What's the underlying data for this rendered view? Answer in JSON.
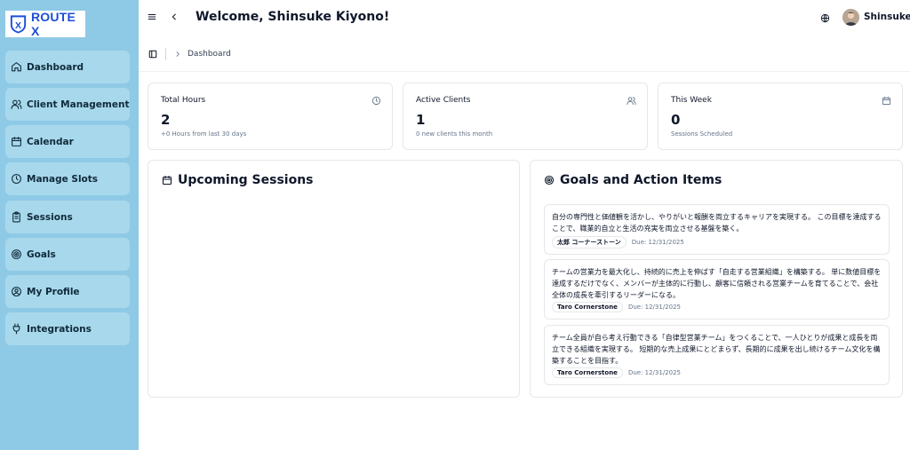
{
  "brand": {
    "logo_text": "ROUTE X",
    "logo_badge": "ROUTE"
  },
  "sidebar": {
    "items": [
      {
        "label": "Dashboard",
        "icon": "home-icon"
      },
      {
        "label": "Client Management",
        "icon": "users-icon"
      },
      {
        "label": "Calendar",
        "icon": "calendar-icon"
      },
      {
        "label": "Manage Slots",
        "icon": "clock-icon"
      },
      {
        "label": "Sessions",
        "icon": "clipboard-icon"
      },
      {
        "label": "Goals",
        "icon": "target-icon"
      },
      {
        "label": "My Profile",
        "icon": "user-circle-icon"
      },
      {
        "label": "Integrations",
        "icon": "plug-icon"
      }
    ]
  },
  "header": {
    "welcome": "Welcome, Shinsuke Kiyono!",
    "user_name": "Shinsuke"
  },
  "breadcrumb": {
    "current": "Dashboard"
  },
  "stats": [
    {
      "title": "Total Hours",
      "value": "2",
      "sub": "+0 Hours from last 30 days",
      "icon": "clock-icon"
    },
    {
      "title": "Active Clients",
      "value": "1",
      "sub": "0 new clients this month",
      "icon": "users-icon"
    },
    {
      "title": "This Week",
      "value": "0",
      "sub": "Sessions Scheduled",
      "icon": "calendar-icon"
    }
  ],
  "sessions": {
    "title": "Upcoming Sessions"
  },
  "goals": {
    "title": "Goals and Action Items",
    "items": [
      {
        "text": "自分の専門性と価値観を活かし、やりがいと報酬を両立するキャリアを実現する。 この目標を達成することで、職業的自立と生活の充実を両立させる基盤を築く。",
        "owner": "太郎 コーナーストーン",
        "due": "Due: 12/31/2025"
      },
      {
        "text": "チームの営業力を最大化し、持続的に売上を伸ばす「自走する営業組織」を構築する。 単に数値目標を達成するだけでなく、メンバーが主体的に行動し、顧客に信頼される営業チームを育てることで、会社全体の成長を牽引するリーダーになる。",
        "owner": "Taro Cornerstone",
        "due": "Due: 12/31/2025"
      },
      {
        "text": "チーム全員が自ら考え行動できる「自律型営業チーム」をつくることで、一人ひとりが成果と成長を両立できる組織を実現する。 短期的な売上成果にとどまらず、長期的に成果を出し続けるチーム文化を構築することを目指す。",
        "owner": "Taro Cornerstone",
        "due": "Due: 12/31/2025"
      }
    ]
  }
}
